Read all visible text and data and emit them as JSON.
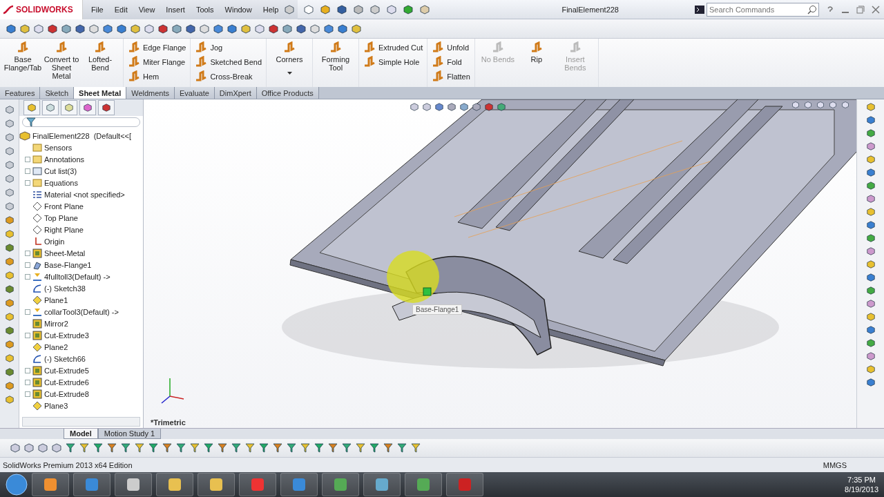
{
  "title_bar": {
    "logo": "SOLIDWORKS",
    "menus": [
      "File",
      "Edit",
      "View",
      "Insert",
      "Tools",
      "Window",
      "Help"
    ],
    "document_title": "FinalElement228",
    "search": {
      "placeholder": "Search Commands"
    }
  },
  "command_manager": {
    "groups": [
      {
        "kind": "large",
        "items": [
          {
            "label": "Base Flange/Tab",
            "disabled": false,
            "dropdown": false
          },
          {
            "label": "Convert to Sheet Metal",
            "disabled": false,
            "dropdown": false
          },
          {
            "label": "Lofted-Bend",
            "disabled": false,
            "dropdown": false
          }
        ]
      },
      {
        "kind": "small",
        "items": [
          {
            "label": "Edge Flange",
            "disabled": false
          },
          {
            "label": "Miter Flange",
            "disabled": false
          },
          {
            "label": "Hem",
            "disabled": false
          }
        ]
      },
      {
        "kind": "small",
        "items": [
          {
            "label": "Jog",
            "disabled": false
          },
          {
            "label": "Sketched Bend",
            "disabled": false
          },
          {
            "label": "Cross-Break",
            "disabled": false
          }
        ]
      },
      {
        "kind": "large",
        "items": [
          {
            "label": "Corners",
            "disabled": false,
            "dropdown": true
          }
        ]
      },
      {
        "kind": "large",
        "items": [
          {
            "label": "Forming Tool",
            "disabled": false,
            "dropdown": false
          }
        ]
      },
      {
        "kind": "small",
        "items": [
          {
            "label": "Extruded Cut",
            "disabled": false
          },
          {
            "label": "Simple Hole",
            "disabled": false
          }
        ]
      },
      {
        "kind": "small",
        "items": [
          {
            "label": "Unfold",
            "disabled": false
          },
          {
            "label": "Fold",
            "disabled": false
          },
          {
            "label": "Flatten",
            "disabled": false
          }
        ]
      },
      {
        "kind": "large",
        "items": [
          {
            "label": "No Bends",
            "disabled": true,
            "dropdown": false
          },
          {
            "label": "Rip",
            "disabled": false,
            "dropdown": false
          },
          {
            "label": "Insert Bends",
            "disabled": true,
            "dropdown": false
          }
        ]
      }
    ]
  },
  "tabs": [
    {
      "label": "Features",
      "selected": false
    },
    {
      "label": "Sketch",
      "selected": false
    },
    {
      "label": "Sheet Metal",
      "selected": true
    },
    {
      "label": "Weldments",
      "selected": false
    },
    {
      "label": "Evaluate",
      "selected": false
    },
    {
      "label": "DimXpert",
      "selected": false
    },
    {
      "label": "Office Products",
      "selected": false
    }
  ],
  "feature_tree": {
    "root": {
      "label": "FinalElement228  (Default<<[",
      "children": [
        {
          "label": "Sensors",
          "kind": "sensor",
          "collapsed": false
        },
        {
          "label": "Annotations",
          "kind": "annotation",
          "collapsed": true
        },
        {
          "label": "Cut list(3)",
          "kind": "cutlist",
          "collapsed": true
        },
        {
          "label": "Equations",
          "kind": "equation",
          "collapsed": true
        },
        {
          "label": "Material <not specified>",
          "kind": "material",
          "collapsed": false
        },
        {
          "label": "Front Plane",
          "kind": "plane",
          "collapsed": false
        },
        {
          "label": "Top Plane",
          "kind": "plane",
          "collapsed": false
        },
        {
          "label": "Right Plane",
          "kind": "plane",
          "collapsed": false
        },
        {
          "label": "Origin",
          "kind": "origin",
          "collapsed": false
        },
        {
          "label": "Sheet-Metal",
          "kind": "feature",
          "collapsed": true
        },
        {
          "label": "Base-Flange1",
          "kind": "flange",
          "collapsed": true
        },
        {
          "label": "4fulltoll3(Default) ->",
          "kind": "formtool",
          "collapsed": true
        },
        {
          "label": "(-) Sketch38",
          "kind": "sketch",
          "collapsed": false
        },
        {
          "label": "Plane1",
          "kind": "refplane",
          "collapsed": false
        },
        {
          "label": "collarTool3(Default) ->",
          "kind": "formtool",
          "collapsed": true
        },
        {
          "label": "Mirror2",
          "kind": "feature",
          "collapsed": false
        },
        {
          "label": "Cut-Extrude3",
          "kind": "feature",
          "collapsed": true
        },
        {
          "label": "Plane2",
          "kind": "refplane",
          "collapsed": false
        },
        {
          "label": "(-) Sketch66",
          "kind": "sketch",
          "collapsed": false
        },
        {
          "label": "Cut-Extrude5",
          "kind": "feature",
          "collapsed": true
        },
        {
          "label": "Cut-Extrude6",
          "kind": "feature",
          "collapsed": true
        },
        {
          "label": "Cut-Extrude8",
          "kind": "feature",
          "collapsed": true
        },
        {
          "label": "Plane3",
          "kind": "refplane",
          "collapsed": false
        }
      ]
    }
  },
  "viewport": {
    "view_label": "*Trimetric",
    "tooltip": "Base-Flange1"
  },
  "bottom_tabs": [
    {
      "label": "Model",
      "selected": true
    },
    {
      "label": "Motion Study 1",
      "selected": false
    }
  ],
  "status_bar": {
    "text": "SolidWorks Premium 2013 x64 Edition",
    "units": "MMGS"
  },
  "taskbar": {
    "time": "7:35 PM",
    "date": "8/19/2013"
  }
}
